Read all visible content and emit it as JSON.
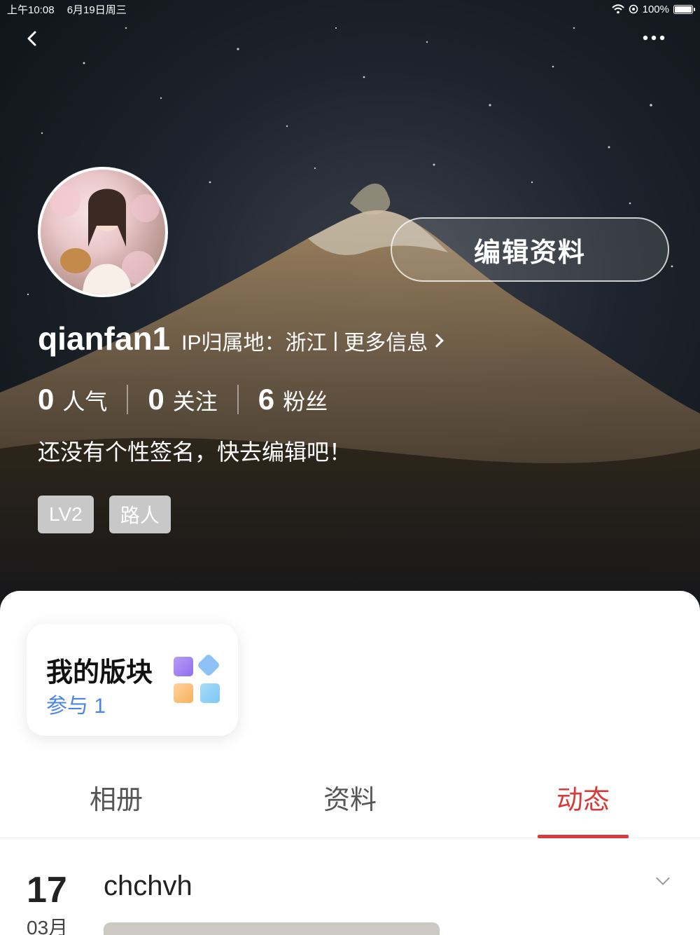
{
  "status_bar": {
    "time": "上午10:08",
    "date": "6月19日周三",
    "battery": "100%",
    "battery_level": 1.0
  },
  "profile": {
    "username": "qianfan1",
    "ip_label": "IP归属地：浙江",
    "more_info": "更多信息",
    "edit_button": "编辑资料",
    "stats": [
      {
        "value": "0",
        "label": "人气"
      },
      {
        "value": "0",
        "label": "关注"
      },
      {
        "value": "6",
        "label": "粉丝"
      }
    ],
    "bio": "还没有个性签名，快去编辑吧！",
    "tags": [
      "LV2",
      "路人"
    ]
  },
  "board_card": {
    "title": "我的版块",
    "count": "参与 1"
  },
  "tabs": [
    {
      "label": "相册",
      "active": false
    },
    {
      "label": "资料",
      "active": false
    },
    {
      "label": "动态",
      "active": true
    }
  ],
  "post": {
    "day": "17",
    "month": "03月",
    "title": "chchvh"
  },
  "colors": {
    "accent_red": "#d73b3b",
    "link_blue": "#4a86e8"
  }
}
